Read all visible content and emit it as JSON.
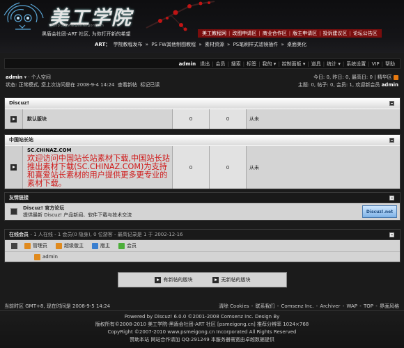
{
  "header": {
    "logo_text": "美工学院",
    "logo_url": "http://www.psmeigong.cn",
    "tagline": "黑盾会社团-ART 社区, 为你打开新的希望",
    "top_nav": [
      "美工教程网",
      "改图申请区",
      "商业合作区",
      "版主申请区",
      "投诉建议区",
      "论坛公告区"
    ],
    "art_prefix": "ART：",
    "art_links": [
      "学院教程发布",
      "PS FW其他制图教程",
      "素材资源",
      "PS笔刷样式滤镜插件",
      "桌面美化"
    ]
  },
  "menubar": {
    "user": "admin",
    "items": [
      "退出",
      "会员",
      "搜索",
      "标签",
      "我的 ▾",
      "控制面板 ▾",
      "道具",
      "统计 ▾",
      "系统设置",
      "VIP",
      "帮助"
    ]
  },
  "user_info": {
    "name": "admin",
    "space": "个人空间",
    "status": "状态: 正常模式, 您上次访问是在 2008-9-4 14:24",
    "view_new": "查看新帖",
    "mark_read": "标记已读",
    "today": "今日: 0, 昨日: 0, 最高日: 0",
    "digest": "精华区",
    "stats": "主题: 0, 帖子: 0, 会员: 1, 欢迎新会员",
    "newest": "admin"
  },
  "sections": [
    {
      "title": "Discuz!",
      "forum": "默认版块",
      "threads": "0",
      "posts": "0",
      "last": "从未"
    },
    {
      "title": "中国站长站",
      "forum": "SC.CHINAZ.COM",
      "watermark": "欢迎访问中国站长站素材下载,中国站长站推出素材下载(SC.CHINAZ.COM)为支持和喜爱站长素材的用户提供更多更专业的素材下载。",
      "threads": "0",
      "posts": "0",
      "last": "从未"
    }
  ],
  "links": {
    "title": "友情链接",
    "site": "Discuz! 官方论坛",
    "desc": "提供最新 Discuz! 产品新闻、软件下载与技术交流",
    "badge": "Discuz!.net"
  },
  "online": {
    "title": "在线会员",
    "summary": "- 1 人在线 - 1 会员(0 隐身), 0 位游客 - 最高记录是 1 于 2002-12-16",
    "legend": [
      {
        "label": "管理员",
        "color": "#e08a1e"
      },
      {
        "label": "超级版主",
        "color": "#e08a1e"
      },
      {
        "label": "版主",
        "color": "#3a7fd0"
      },
      {
        "label": "会员",
        "color": "#4cae3a"
      }
    ],
    "user": "admin"
  },
  "post_legend": {
    "new": "有新帖的版块",
    "none": "无新帖的版块"
  },
  "footbar": {
    "time": "当前时区 GMT+8, 现在时间是 2008-9-5 14:24",
    "links": [
      "清除 Cookies",
      "联系我们",
      "Comsenz Inc.",
      "Archiver",
      "WAP",
      "TOP",
      "界面风格"
    ]
  },
  "footer": {
    "powered": "Powered by Discuz! 6.0.0 ©2001-2008 Comsenz Inc. Design By",
    "copy1": "版权所有©2008-2010 美工学院-黑盾会社团-ART 社区 [psmeigong.cn] 推荐分辨率 1024×768",
    "copy2": "CopyRight ©2007-2010 www.psmeigong.cn Incorporated All Rights Reserved",
    "copy3": "赞助本站 网站合作请加 QQ:291249 本服务器需宽由卓越数据提供"
  }
}
